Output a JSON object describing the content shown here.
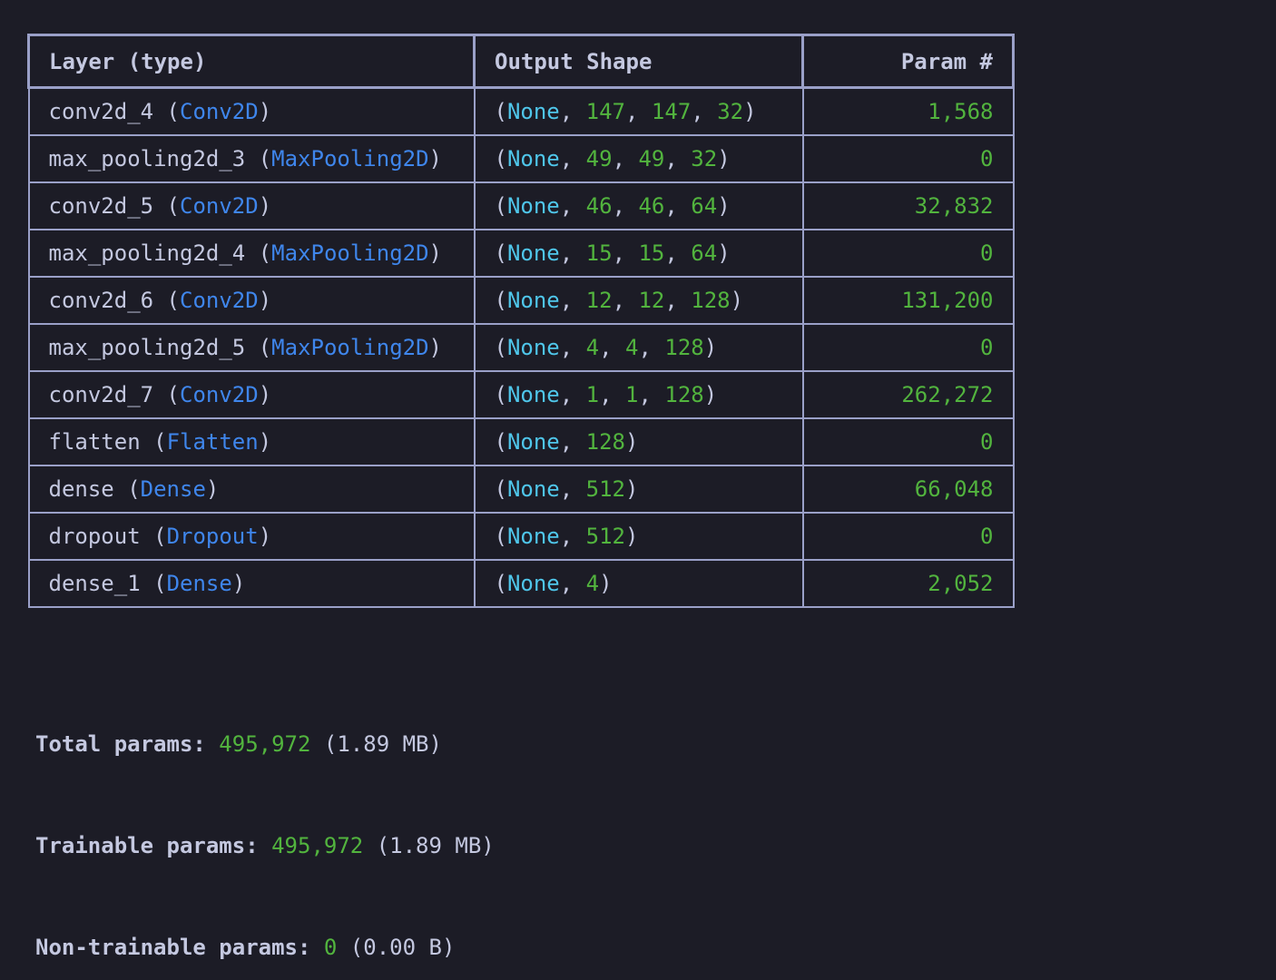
{
  "table": {
    "headers": {
      "layer": "Layer (type)",
      "shape": "Output Shape",
      "param": "Param #"
    },
    "rows": [
      {
        "name": "conv2d_4",
        "type": "Conv2D",
        "shape": [
          "None",
          "147",
          "147",
          "32"
        ],
        "params": "1,568"
      },
      {
        "name": "max_pooling2d_3",
        "type": "MaxPooling2D",
        "shape": [
          "None",
          "49",
          "49",
          "32"
        ],
        "params": "0"
      },
      {
        "name": "conv2d_5",
        "type": "Conv2D",
        "shape": [
          "None",
          "46",
          "46",
          "64"
        ],
        "params": "32,832"
      },
      {
        "name": "max_pooling2d_4",
        "type": "MaxPooling2D",
        "shape": [
          "None",
          "15",
          "15",
          "64"
        ],
        "params": "0"
      },
      {
        "name": "conv2d_6",
        "type": "Conv2D",
        "shape": [
          "None",
          "12",
          "12",
          "128"
        ],
        "params": "131,200"
      },
      {
        "name": "max_pooling2d_5",
        "type": "MaxPooling2D",
        "shape": [
          "None",
          "4",
          "4",
          "128"
        ],
        "params": "0"
      },
      {
        "name": "conv2d_7",
        "type": "Conv2D",
        "shape": [
          "None",
          "1",
          "1",
          "128"
        ],
        "params": "262,272"
      },
      {
        "name": "flatten",
        "type": "Flatten",
        "shape": [
          "None",
          "128"
        ],
        "params": "0"
      },
      {
        "name": "dense",
        "type": "Dense",
        "shape": [
          "None",
          "512"
        ],
        "params": "66,048"
      },
      {
        "name": "dropout",
        "type": "Dropout",
        "shape": [
          "None",
          "512"
        ],
        "params": "0"
      },
      {
        "name": "dense_1",
        "type": "Dense",
        "shape": [
          "None",
          "4"
        ],
        "params": "2,052"
      }
    ]
  },
  "totals": {
    "total": {
      "label": "Total params:",
      "value": "495,972",
      "size": "(1.89 MB)"
    },
    "trainable": {
      "label": "Trainable params:",
      "value": "495,972",
      "size": "(1.89 MB)"
    },
    "non_trainable": {
      "label": "Non-trainable params:",
      "value": "0",
      "size": "(0.00 B)"
    }
  },
  "colors": {
    "background": "#1c1c26",
    "border": "#9aa0c8",
    "text": "#c4c8e0",
    "type": "#3f86ec",
    "none": "#4fc6ea",
    "number": "#52b43e"
  }
}
